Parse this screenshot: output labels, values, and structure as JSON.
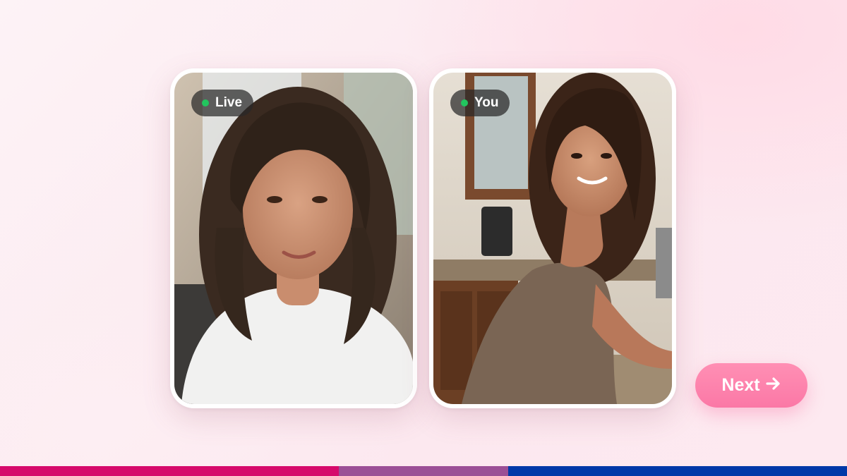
{
  "cards": [
    {
      "badge": "Live",
      "status_color": "#22c55e"
    },
    {
      "badge": "You",
      "status_color": "#22c55e"
    }
  ],
  "next_button": {
    "label": "Next",
    "icon": "arrow-right-icon"
  },
  "stripe_colors": [
    "#d6096b",
    "#9b4f96",
    "#0038a8"
  ],
  "accent": "#fb7aa6"
}
